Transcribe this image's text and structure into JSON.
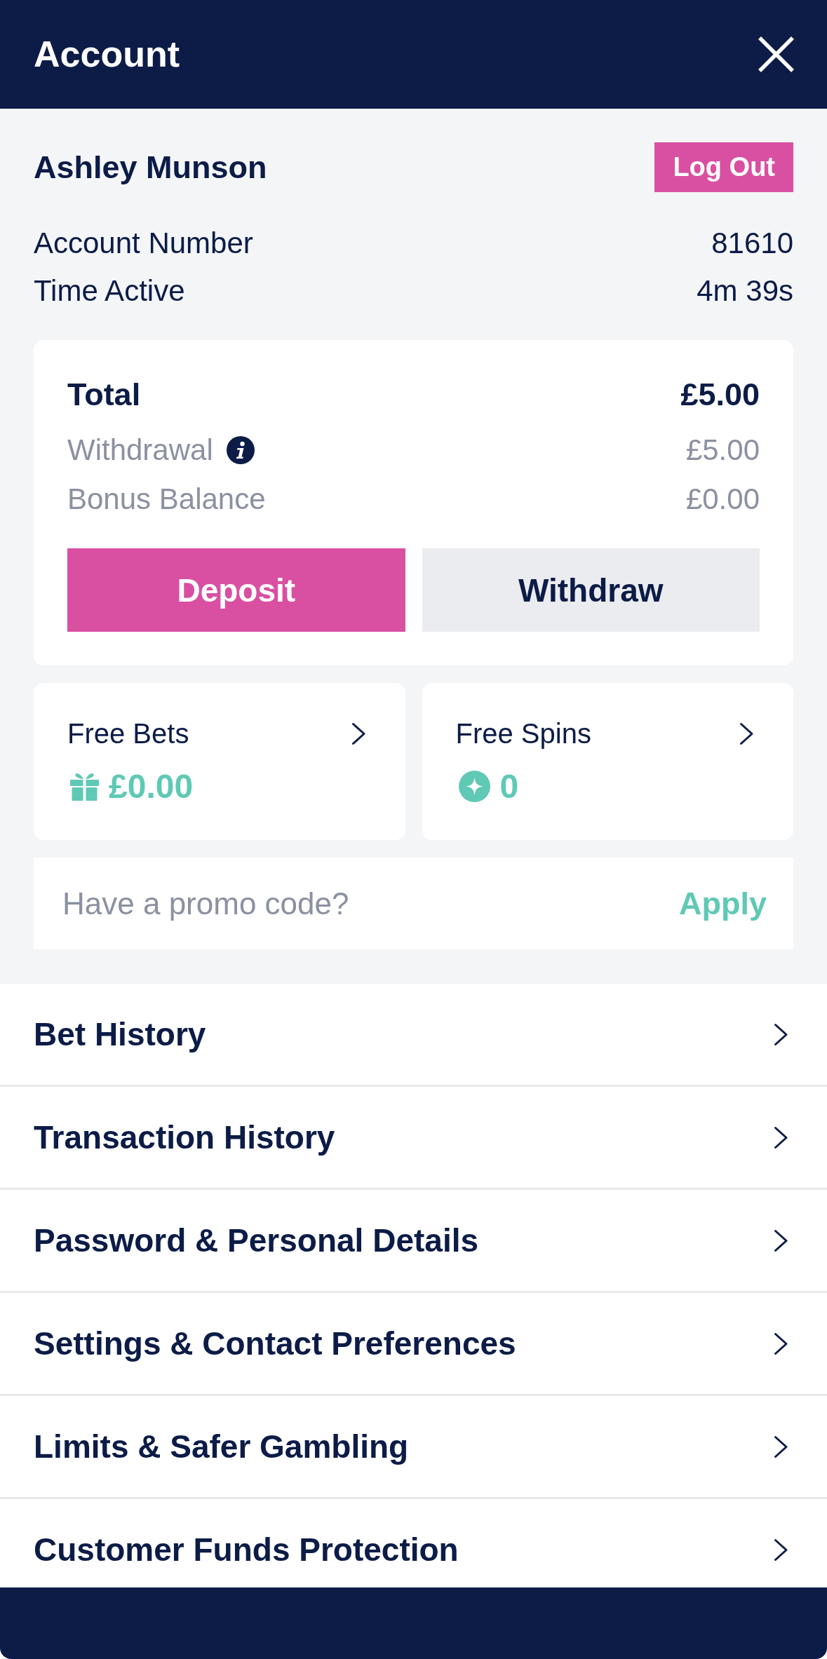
{
  "header": {
    "title": "Account"
  },
  "user": {
    "name": "Ashley Munson",
    "logout_label": "Log Out",
    "details": [
      {
        "label": "Account Number",
        "value": "81610"
      },
      {
        "label": "Time Active",
        "value": "4m 39s"
      }
    ]
  },
  "balance": {
    "total": {
      "label": "Total",
      "value": "£5.00"
    },
    "lines": [
      {
        "label": "Withdrawal",
        "value": "£5.00",
        "info": true
      },
      {
        "label": "Bonus Balance",
        "value": "£0.00",
        "info": false
      }
    ],
    "buttons": [
      {
        "label": "Deposit",
        "kind": "primary"
      },
      {
        "label": "Withdraw",
        "kind": "secondary"
      }
    ]
  },
  "rewards": [
    {
      "label": "Free Bets",
      "value": "£0.00",
      "kind": "gift"
    },
    {
      "label": "Free Spins",
      "value": "0",
      "kind": "spin"
    }
  ],
  "promo": {
    "placeholder": "Have a promo code?",
    "action": "Apply"
  },
  "menu": [
    {
      "label": "Bet History"
    },
    {
      "label": "Transaction History"
    },
    {
      "label": "Password & Personal Details"
    },
    {
      "label": "Settings & Contact Preferences"
    },
    {
      "label": "Limits & Safer Gambling"
    },
    {
      "label": "Customer Funds Protection"
    }
  ]
}
